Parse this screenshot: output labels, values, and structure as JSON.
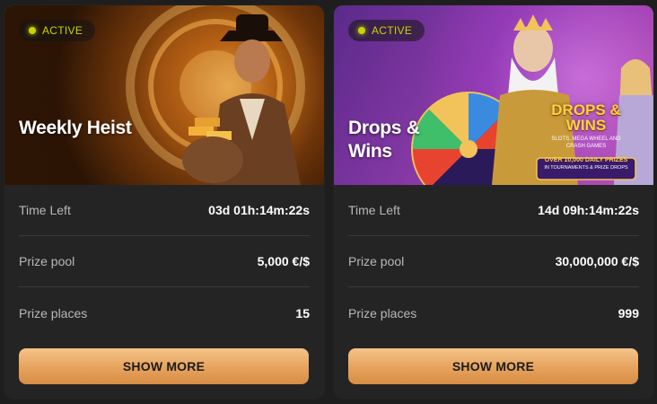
{
  "tournaments": [
    {
      "status": "ACTIVE",
      "title": "Weekly Heist",
      "rows": [
        {
          "label": "Time Left",
          "value": "03d  01h:14m:22s"
        },
        {
          "label": "Prize pool",
          "value": "5,000 €/$"
        },
        {
          "label": "Prize places",
          "value": "15"
        }
      ],
      "button": "SHOW MORE"
    },
    {
      "status": "ACTIVE",
      "title": "Drops & Wins",
      "logo_title": "DROPS & WINS",
      "logo_sub": "SLOTS, MEGA WHEEL AND CRASH GAMES",
      "logo_prize": "OVER 10,000 DAILY PRIZES",
      "logo_prize_sub": "IN TOURNAMENTS & PRIZE DROPS",
      "rows": [
        {
          "label": "Time Left",
          "value": "14d  09h:14m:22s"
        },
        {
          "label": "Prize pool",
          "value": "30,000,000 €/$"
        },
        {
          "label": "Prize places",
          "value": "999"
        }
      ],
      "button": "SHOW MORE"
    }
  ],
  "colors": {
    "background": "#1e1e1e",
    "card": "#242424",
    "active_badge": "#c8d400",
    "button": "#e6a25c"
  }
}
